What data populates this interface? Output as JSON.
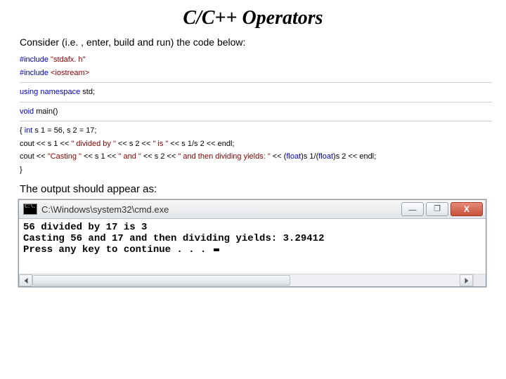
{
  "title": "C/C++  Operators",
  "intro_prefix": "Consider (i.e",
  "intro_rest": ". , enter, build and run) the code below:",
  "code": {
    "inc1_pre": "#include ",
    "inc1_str": "\"stdafx. h\"",
    "inc2_pre": "#include ",
    "inc2_ang": "<iostream>",
    "using_kw": "using ",
    "using_ns": "namespace ",
    "using_name": "std;",
    "void_kw": "void ",
    "main_decl": "main()",
    "body_open": "{  ",
    "int_kw": "int ",
    "decl_rest": "s 1 = 56, s 2 = 17;",
    "indent": "   ",
    "cout1_a": "cout << s 1 << ",
    "str_divby": "\" divided by \"",
    "cout1_b": " << s 2 << ",
    "str_is": "\" is \"",
    "cout1_c": " << s 1/s 2 << endl;",
    "cout2_a": "cout << ",
    "str_casting": "\"Casting \"",
    "cout2_b": " << s 1 << ",
    "str_and": "\" and \"",
    "cout2_c": " << s 2 << ",
    "str_then": "\" and then dividing yields: \"",
    "cout2_d": " << (",
    "float_kw1": "float",
    "cout2_e": ")s 1/(",
    "float_kw2": "float",
    "cout2_f": ")s 2 << endl;",
    "body_close": "}"
  },
  "output_label": "The output should appear as:",
  "console": {
    "icon_text": "C:\\.",
    "title": "C:\\Windows\\system32\\cmd.exe",
    "min_glyph": "—",
    "max_glyph": "❐",
    "close_glyph": "X",
    "line1": "56 divided by 17 is 3",
    "line2": "Casting 56 and 17 and then dividing yields: 3.29412",
    "line3": "Press any key to continue . . . "
  }
}
